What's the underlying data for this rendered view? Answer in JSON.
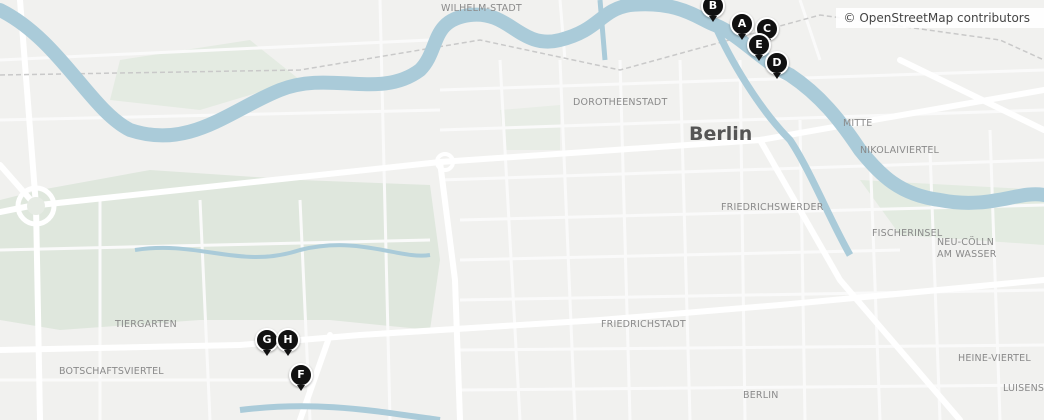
{
  "map": {
    "attribution": "© OpenStreetMap contributors",
    "city_label": "Berlin",
    "district_labels": {
      "wilhelm_stadt": "WILHELM-STADT",
      "dorotheenstadt": "DOROTHEENSTADT",
      "mitte": "MITTE",
      "nikolaiviertel": "NIKOLAIVIERTEL",
      "friedrichswerder": "FRIEDRICHSWERDER",
      "fischerinsel": "FISCHERINSEL",
      "neu_colln_line1": "NEU-CÖLLN",
      "neu_colln_line2": "AM WASSER",
      "tiergarten": "TIERGARTEN",
      "friedrichstadt": "FRIEDRICHSTADT",
      "botschaftsviertel": "BOTSCHAFTSVIERTEL",
      "berlin": "BERLIN",
      "heine_viertel": "HEINE-VIERTEL",
      "luisenstadt": "LUISENST"
    },
    "colors": {
      "water": "#aacbd9",
      "park": "#dde7dc",
      "road": "#ffffff",
      "marker": "#111111"
    },
    "markers": [
      {
        "label": "A"
      },
      {
        "label": "B"
      },
      {
        "label": "C"
      },
      {
        "label": "D"
      },
      {
        "label": "E"
      },
      {
        "label": "F"
      },
      {
        "label": "G"
      },
      {
        "label": "H"
      }
    ]
  }
}
